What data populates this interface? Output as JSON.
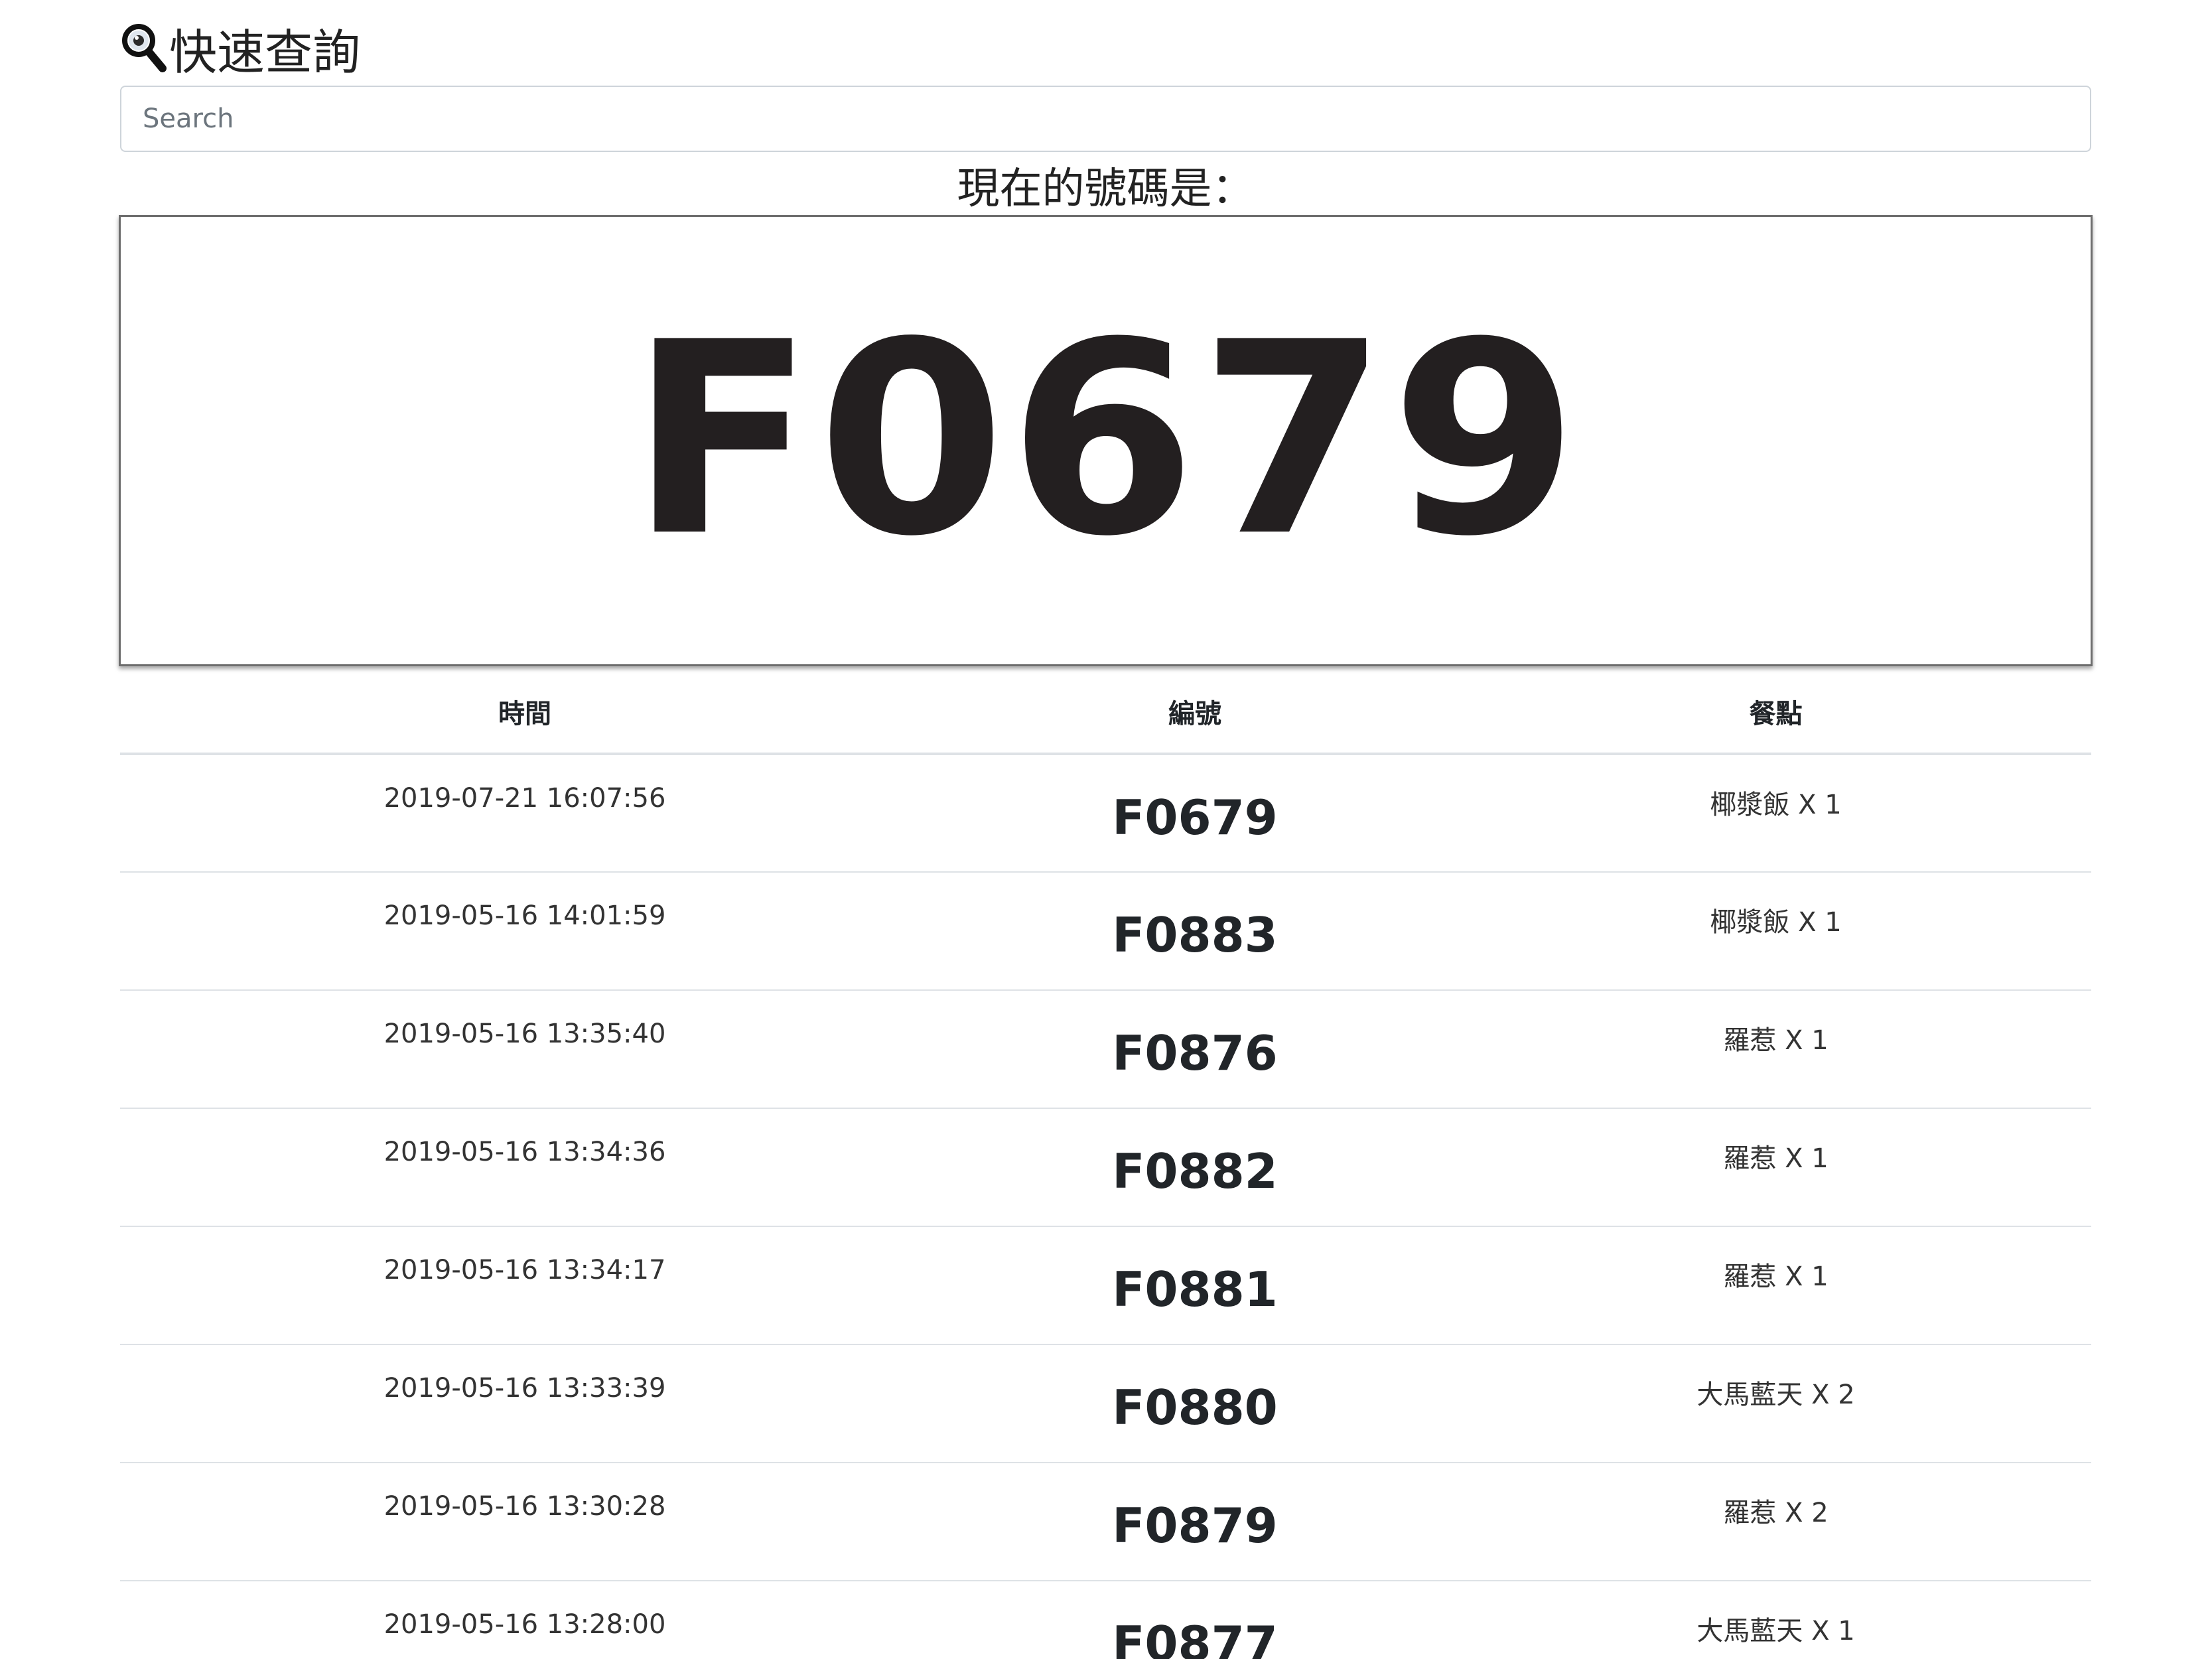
{
  "header": {
    "title": "快速查詢",
    "icon": "search-icon"
  },
  "search": {
    "placeholder": "Search",
    "value": ""
  },
  "current": {
    "label": "現在的號碼是：",
    "number": "F0679"
  },
  "table": {
    "columns": [
      "時間",
      "編號",
      "餐點"
    ],
    "rows": [
      {
        "time": "2019-07-21 16:07:56",
        "number": "F0679",
        "meal": "椰漿飯 X 1"
      },
      {
        "time": "2019-05-16 14:01:59",
        "number": "F0883",
        "meal": "椰漿飯 X 1"
      },
      {
        "time": "2019-05-16 13:35:40",
        "number": "F0876",
        "meal": "羅惹 X 1"
      },
      {
        "time": "2019-05-16 13:34:36",
        "number": "F0882",
        "meal": "羅惹 X 1"
      },
      {
        "time": "2019-05-16 13:34:17",
        "number": "F0881",
        "meal": "羅惹 X 1"
      },
      {
        "time": "2019-05-16 13:33:39",
        "number": "F0880",
        "meal": "大馬藍天 X 2"
      },
      {
        "time": "2019-05-16 13:30:28",
        "number": "F0879",
        "meal": "羅惹 X 2"
      },
      {
        "time": "2019-05-16 13:28:00",
        "number": "F0877",
        "meal": "大馬藍天 X 1"
      }
    ]
  }
}
